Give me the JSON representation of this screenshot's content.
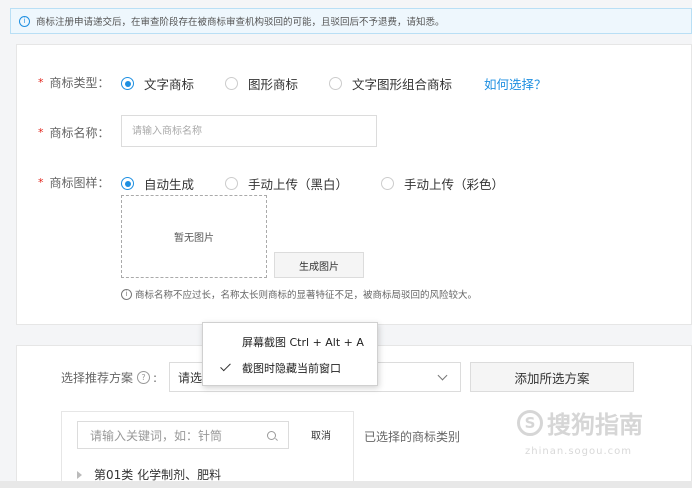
{
  "notice": {
    "icon": "info-icon",
    "text": "商标注册申请递交后，在审查阶段存在被商标审查机构驳回的可能，且驳回后不予退费，请知悉。"
  },
  "form": {
    "required_mark": "*",
    "type": {
      "label": "商标类型：",
      "options": [
        "文字商标",
        "图形商标",
        "文字图形组合商标"
      ],
      "selected": "文字商标",
      "help_link": "如何选择？"
    },
    "name": {
      "label": "商标名称：",
      "placeholder": "请输入商标名称",
      "value": ""
    },
    "pattern": {
      "label": "商标图样：",
      "options": [
        "自动生成",
        "手动上传（黑白）",
        "手动上传（彩色）"
      ],
      "selected": "自动生成",
      "preview_text": "暂无图片",
      "generate_button": "生成图片",
      "hint": "商标名称不应过长，名称太长则商标的显著特征不足，被商标局驳回的风险较大。"
    }
  },
  "scheme": {
    "label": "选择推荐方案",
    "select_value": "请选",
    "add_all_button": "添加所选方案"
  },
  "category": {
    "search_placeholder": "请输入关键词，如：针筒",
    "cancel": "取消",
    "items": [
      "第01类 化学制剂、肥料"
    ],
    "selected_title": "已选择的商标类别"
  },
  "context_menu": {
    "items": [
      {
        "label": "屏幕截图 Ctrl + Alt + A",
        "checked": false
      },
      {
        "label": "截图时隐藏当前窗口",
        "checked": true
      }
    ]
  },
  "watermark": {
    "text": "搜狗指南",
    "url": "zhinan.sogou.com"
  },
  "colors": {
    "accent": "#1e8fe1",
    "required": "#e2231a",
    "notice_bg": "#eef7fd"
  }
}
